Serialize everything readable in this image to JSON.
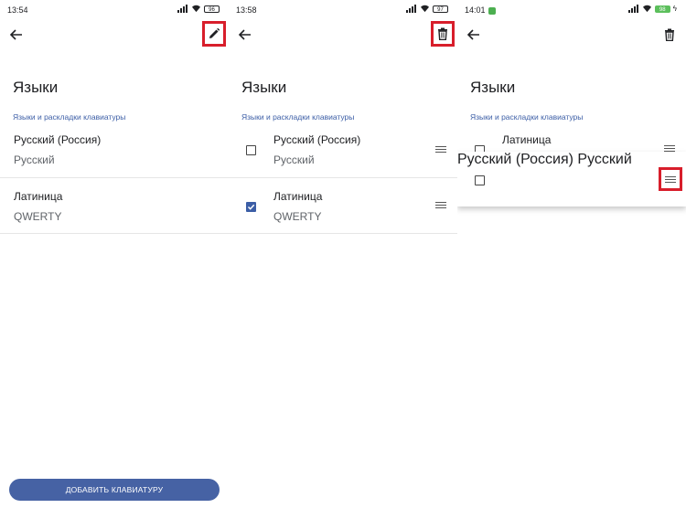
{
  "panels": [
    {
      "time": "13:54",
      "battery": "96",
      "title": "Языки",
      "section": "Языки и раскладки клавиатуры",
      "items": [
        {
          "main": "Русский (Россия)",
          "sub": "Русский"
        },
        {
          "main": "Латиница",
          "sub": "QWERTY"
        }
      ],
      "add_button": "ДОБАВИТЬ КЛАВИАТУРУ",
      "action_icon": "pencil-icon"
    },
    {
      "time": "13:58",
      "battery": "97",
      "title": "Языки",
      "section": "Языки и раскладки клавиатуры",
      "items": [
        {
          "main": "Русский (Россия)",
          "sub": "Русский",
          "checked": false
        },
        {
          "main": "Латиница",
          "sub": "QWERTY",
          "checked": true
        }
      ],
      "action_icon": "trash-icon"
    },
    {
      "time": "14:01",
      "battery": "98",
      "title": "Языки",
      "section": "Языки и раскладки клавиатуры",
      "items": [
        {
          "main": "Латиница",
          "checked": false
        },
        {
          "main": "Русский (Россия)",
          "sub": "Русский",
          "checked": false
        }
      ],
      "action_icon": "trash-icon"
    }
  ],
  "colors": {
    "accent": "#4662a4",
    "highlight": "#d81e2b",
    "section": "#3c5ea6"
  }
}
